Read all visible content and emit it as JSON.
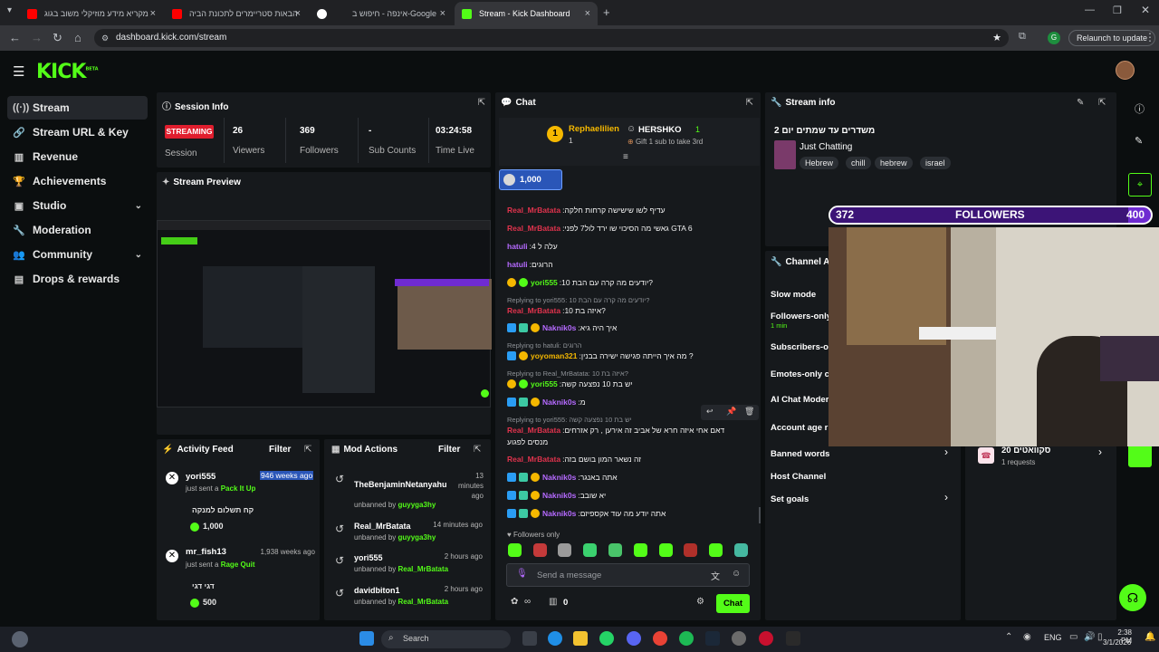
{
  "browser": {
    "tabs": [
      {
        "label": "מקריא מידע מוזיקלי משוב בגוג"
      },
      {
        "label": "הבאות סטריימרים לתכונת הביה"
      },
      {
        "label": "אינפה - חיפוש ב-Google"
      },
      {
        "label": "Stream - Kick Dashboard"
      }
    ],
    "url": "dashboard.kick.com/stream",
    "relaunch_label": "Relaunch to update",
    "profile_initial": "G"
  },
  "header": {
    "logo": "KICK",
    "logo_beta": "BETA"
  },
  "sidebar": {
    "items": [
      {
        "label": "Stream"
      },
      {
        "label": "Stream URL & Key"
      },
      {
        "label": "Revenue"
      },
      {
        "label": "Achievements"
      },
      {
        "label": "Studio"
      },
      {
        "label": "Moderation"
      },
      {
        "label": "Community"
      },
      {
        "label": "Drops & rewards"
      }
    ]
  },
  "session": {
    "title": "Session Info",
    "status": "STREAMING",
    "status_label": "Session",
    "viewers": "26",
    "viewers_label": "Viewers",
    "followers": "369",
    "followers_label": "Followers",
    "subs": "-",
    "subs_label": "Sub Counts",
    "time": "03:24:58",
    "time_label": "Time Live"
  },
  "preview": {
    "title": "Stream Preview"
  },
  "activity": {
    "title": "Activity Feed",
    "filter": "Filter",
    "items": [
      {
        "user": "yori555",
        "time": "946 weeks ago",
        "action_prefix": "just sent a",
        "action": "Pack It Up",
        "message": "קח תשלום למנקה",
        "amount": "1,000"
      },
      {
        "user": "mr_fish13",
        "time": "1,938 weeks ago",
        "action_prefix": "just sent a",
        "action": "Rage Quit",
        "message": "דגי דגי",
        "amount": "500"
      }
    ]
  },
  "mod": {
    "title": "Mod Actions",
    "filter": "Filter",
    "items": [
      {
        "user": "TheBenjaminNetanyahu",
        "time": "13 minutes ago",
        "action": "unbanned by",
        "by": "guyyga3hy"
      },
      {
        "user": "Real_MrBatata",
        "time": "14 minutes ago",
        "action": "unbanned by",
        "by": "guyyga3hy"
      },
      {
        "user": "yori555",
        "time": "2 hours ago",
        "action": "unbanned by",
        "by": "Real_MrBatata"
      },
      {
        "user": "davidbiton1",
        "time": "2 hours ago",
        "action": "unbanned by",
        "by": "Real_MrBatata"
      }
    ]
  },
  "chat": {
    "title": "Chat",
    "top_gifter": "Rephaelilien",
    "top_gifter_count": "1",
    "gifter2": "HERSHKO",
    "gifter2_count": "1",
    "gift_prompt": "Gift 1 sub to take 3rd",
    "pinned_amount": "1,000",
    "messages": [
      {
        "user": "Real_MrBatata",
        "text": "עדיף לשו שישישה קרחות חלקה"
      },
      {
        "user": "Real_MrBatata",
        "text": "גאשי מה הסיכוי שו ירד לול7 לפני GTA 6"
      },
      {
        "user": "hatuli",
        "text": "עלה ל 4"
      },
      {
        "user": "hatuli",
        "text": "הרוגים"
      },
      {
        "user": "yori555",
        "text": "יודעים מה קרה עם הבת 10?"
      },
      {
        "reply": "Replying to yori555: יודעים מה קרה עם הבת 10?"
      },
      {
        "user": "Real_MrBatata",
        "text": "איזה בת 10?"
      },
      {
        "user": "Naknik0s",
        "text": "איך היה גיא"
      },
      {
        "reply": "Replying to hatuli: הרוגים"
      },
      {
        "user": "yoyoman321",
        "text": "מה איך הייתה פגישה ישירה בבנין ?"
      },
      {
        "reply": "Replying to Real_MrBatata: איזה בת 10?"
      },
      {
        "user": "yori555",
        "text": "יש בת 10 נפצעה קשה"
      },
      {
        "user": "Naknik0s",
        "text": "מ"
      },
      {
        "reply": "Replying to yori555: יש בת 10 נפצעה קשה"
      },
      {
        "user": "Real_MrBatata",
        "text": "דאם אחי איזה חרא של אביב זה אירען , רק אזרחים"
      },
      {
        "text": "מנסים לפגוע"
      },
      {
        "user": "Real_MrBatata",
        "text": "זה נשאר המון בושם בזה"
      },
      {
        "user": "Naknik0s",
        "text": "אתה באנגר"
      },
      {
        "user": "Naknik0s",
        "text": "יא שובב"
      },
      {
        "user": "Naknik0s",
        "text": "אתה יודע מה עוד אקספיזם"
      }
    ],
    "followers_only": "Followers only",
    "input_placeholder": "Send a message",
    "points": "0",
    "send_label": "Chat"
  },
  "stream_info": {
    "title": "Stream info",
    "stream_title": "משדרים עד שמתים יום 2",
    "category": "Just Chatting",
    "tags": [
      "Hebrew",
      "chill",
      "hebrew",
      "israel"
    ]
  },
  "channel_actions": {
    "title": "Channel Ac",
    "items": [
      {
        "label": "Slow mode"
      },
      {
        "label": "Followers-only",
        "sub": "1 min"
      },
      {
        "label": "Subscribers-o"
      },
      {
        "label": "Emotes-only c"
      },
      {
        "label": "AI Chat Moder"
      },
      {
        "label": "Account age r"
      },
      {
        "label": "Banned words"
      },
      {
        "label": "Host Channel"
      },
      {
        "label": "Set goals"
      }
    ]
  },
  "requests": {
    "title": "20 סקוואטים",
    "sub": "1 requests"
  },
  "overlay": {
    "current": "372",
    "label": "FOLLOWERS",
    "goal": "400"
  },
  "taskbar": {
    "search_label": "Search",
    "lang": "ENG",
    "time": "2:38 PM",
    "date": "3/1/2026"
  },
  "colors": {
    "kick_green": "#53fc18",
    "streaming_red": "#e01e2e",
    "goal_purple": "#6f2bd1"
  }
}
